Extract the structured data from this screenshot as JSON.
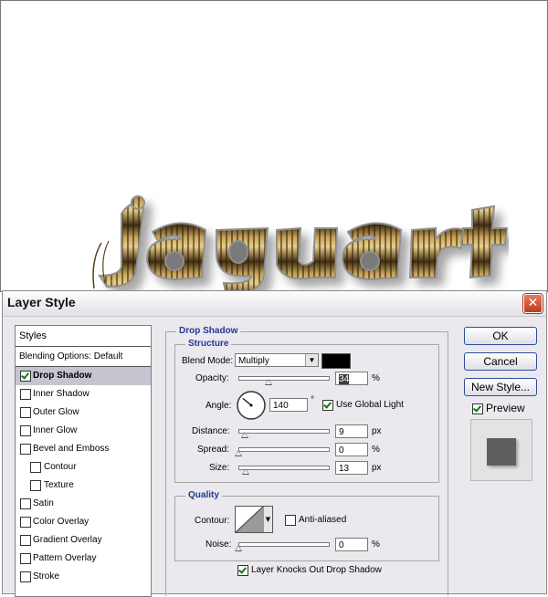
{
  "dialog": {
    "title": "Layer Style",
    "close_glyph": "✕"
  },
  "canvas": {
    "artwork_text": "jaguar"
  },
  "sidebar": {
    "header": "Styles",
    "blending": "Blending Options: Default",
    "items": [
      {
        "label": "Drop Shadow",
        "checked": true,
        "selected": true,
        "indent": false
      },
      {
        "label": "Inner Shadow",
        "checked": false,
        "indent": false
      },
      {
        "label": "Outer Glow",
        "checked": false,
        "indent": false
      },
      {
        "label": "Inner Glow",
        "checked": false,
        "indent": false
      },
      {
        "label": "Bevel and Emboss",
        "checked": false,
        "indent": false
      },
      {
        "label": "Contour",
        "checked": false,
        "indent": true
      },
      {
        "label": "Texture",
        "checked": false,
        "indent": true
      },
      {
        "label": "Satin",
        "checked": false,
        "indent": false
      },
      {
        "label": "Color Overlay",
        "checked": false,
        "indent": false
      },
      {
        "label": "Gradient Overlay",
        "checked": false,
        "indent": false
      },
      {
        "label": "Pattern Overlay",
        "checked": false,
        "indent": false
      },
      {
        "label": "Stroke",
        "checked": false,
        "indent": false
      }
    ]
  },
  "drop_shadow": {
    "title": "Drop Shadow",
    "structure": {
      "title": "Structure",
      "blend_mode_label": "Blend Mode:",
      "blend_mode_value": "Multiply",
      "shadow_color": "#000000",
      "opacity_label": "Opacity:",
      "opacity_value": "34",
      "opacity_fraction": 0.34,
      "percent": "%",
      "angle_label": "Angle:",
      "angle_value": "140",
      "degree": "°",
      "use_global_light_label": "Use Global Light",
      "use_global_light": true,
      "distance_label": "Distance:",
      "distance_value": "9",
      "px": "px",
      "spread_label": "Spread:",
      "spread_value": "0",
      "size_label": "Size:",
      "size_value": "13"
    },
    "quality": {
      "title": "Quality",
      "contour_label": "Contour:",
      "anti_aliased_label": "Anti-aliased",
      "anti_aliased": false,
      "noise_label": "Noise:",
      "noise_value": "0"
    },
    "knocks_out_label": "Layer Knocks Out Drop Shadow",
    "knocks_out": true
  },
  "buttons": {
    "ok": "OK",
    "cancel": "Cancel",
    "new_style": "New Style...",
    "preview_label": "Preview",
    "preview_checked": true
  },
  "colors": {
    "accent": "#1f3a93",
    "close": "#c0391c",
    "checkmark": "#0a7a0a"
  }
}
